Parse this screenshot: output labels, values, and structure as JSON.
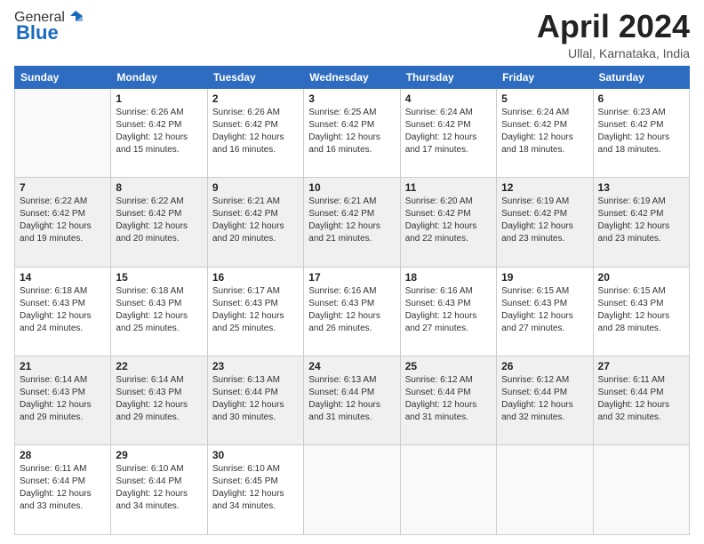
{
  "header": {
    "logo_general": "General",
    "logo_blue": "Blue",
    "month_title": "April 2024",
    "location": "Ullal, Karnataka, India"
  },
  "days_of_week": [
    "Sunday",
    "Monday",
    "Tuesday",
    "Wednesday",
    "Thursday",
    "Friday",
    "Saturday"
  ],
  "weeks": [
    [
      {
        "day": "",
        "info": ""
      },
      {
        "day": "1",
        "info": "Sunrise: 6:26 AM\nSunset: 6:42 PM\nDaylight: 12 hours\nand 15 minutes."
      },
      {
        "day": "2",
        "info": "Sunrise: 6:26 AM\nSunset: 6:42 PM\nDaylight: 12 hours\nand 16 minutes."
      },
      {
        "day": "3",
        "info": "Sunrise: 6:25 AM\nSunset: 6:42 PM\nDaylight: 12 hours\nand 16 minutes."
      },
      {
        "day": "4",
        "info": "Sunrise: 6:24 AM\nSunset: 6:42 PM\nDaylight: 12 hours\nand 17 minutes."
      },
      {
        "day": "5",
        "info": "Sunrise: 6:24 AM\nSunset: 6:42 PM\nDaylight: 12 hours\nand 18 minutes."
      },
      {
        "day": "6",
        "info": "Sunrise: 6:23 AM\nSunset: 6:42 PM\nDaylight: 12 hours\nand 18 minutes."
      }
    ],
    [
      {
        "day": "7",
        "info": "Sunrise: 6:22 AM\nSunset: 6:42 PM\nDaylight: 12 hours\nand 19 minutes."
      },
      {
        "day": "8",
        "info": "Sunrise: 6:22 AM\nSunset: 6:42 PM\nDaylight: 12 hours\nand 20 minutes."
      },
      {
        "day": "9",
        "info": "Sunrise: 6:21 AM\nSunset: 6:42 PM\nDaylight: 12 hours\nand 20 minutes."
      },
      {
        "day": "10",
        "info": "Sunrise: 6:21 AM\nSunset: 6:42 PM\nDaylight: 12 hours\nand 21 minutes."
      },
      {
        "day": "11",
        "info": "Sunrise: 6:20 AM\nSunset: 6:42 PM\nDaylight: 12 hours\nand 22 minutes."
      },
      {
        "day": "12",
        "info": "Sunrise: 6:19 AM\nSunset: 6:42 PM\nDaylight: 12 hours\nand 23 minutes."
      },
      {
        "day": "13",
        "info": "Sunrise: 6:19 AM\nSunset: 6:42 PM\nDaylight: 12 hours\nand 23 minutes."
      }
    ],
    [
      {
        "day": "14",
        "info": "Sunrise: 6:18 AM\nSunset: 6:43 PM\nDaylight: 12 hours\nand 24 minutes."
      },
      {
        "day": "15",
        "info": "Sunrise: 6:18 AM\nSunset: 6:43 PM\nDaylight: 12 hours\nand 25 minutes."
      },
      {
        "day": "16",
        "info": "Sunrise: 6:17 AM\nSunset: 6:43 PM\nDaylight: 12 hours\nand 25 minutes."
      },
      {
        "day": "17",
        "info": "Sunrise: 6:16 AM\nSunset: 6:43 PM\nDaylight: 12 hours\nand 26 minutes."
      },
      {
        "day": "18",
        "info": "Sunrise: 6:16 AM\nSunset: 6:43 PM\nDaylight: 12 hours\nand 27 minutes."
      },
      {
        "day": "19",
        "info": "Sunrise: 6:15 AM\nSunset: 6:43 PM\nDaylight: 12 hours\nand 27 minutes."
      },
      {
        "day": "20",
        "info": "Sunrise: 6:15 AM\nSunset: 6:43 PM\nDaylight: 12 hours\nand 28 minutes."
      }
    ],
    [
      {
        "day": "21",
        "info": "Sunrise: 6:14 AM\nSunset: 6:43 PM\nDaylight: 12 hours\nand 29 minutes."
      },
      {
        "day": "22",
        "info": "Sunrise: 6:14 AM\nSunset: 6:43 PM\nDaylight: 12 hours\nand 29 minutes."
      },
      {
        "day": "23",
        "info": "Sunrise: 6:13 AM\nSunset: 6:44 PM\nDaylight: 12 hours\nand 30 minutes."
      },
      {
        "day": "24",
        "info": "Sunrise: 6:13 AM\nSunset: 6:44 PM\nDaylight: 12 hours\nand 31 minutes."
      },
      {
        "day": "25",
        "info": "Sunrise: 6:12 AM\nSunset: 6:44 PM\nDaylight: 12 hours\nand 31 minutes."
      },
      {
        "day": "26",
        "info": "Sunrise: 6:12 AM\nSunset: 6:44 PM\nDaylight: 12 hours\nand 32 minutes."
      },
      {
        "day": "27",
        "info": "Sunrise: 6:11 AM\nSunset: 6:44 PM\nDaylight: 12 hours\nand 32 minutes."
      }
    ],
    [
      {
        "day": "28",
        "info": "Sunrise: 6:11 AM\nSunset: 6:44 PM\nDaylight: 12 hours\nand 33 minutes."
      },
      {
        "day": "29",
        "info": "Sunrise: 6:10 AM\nSunset: 6:44 PM\nDaylight: 12 hours\nand 34 minutes."
      },
      {
        "day": "30",
        "info": "Sunrise: 6:10 AM\nSunset: 6:45 PM\nDaylight: 12 hours\nand 34 minutes."
      },
      {
        "day": "",
        "info": ""
      },
      {
        "day": "",
        "info": ""
      },
      {
        "day": "",
        "info": ""
      },
      {
        "day": "",
        "info": ""
      }
    ]
  ],
  "row_shading": [
    "row-white",
    "row-shade",
    "row-white",
    "row-shade",
    "row-white"
  ]
}
